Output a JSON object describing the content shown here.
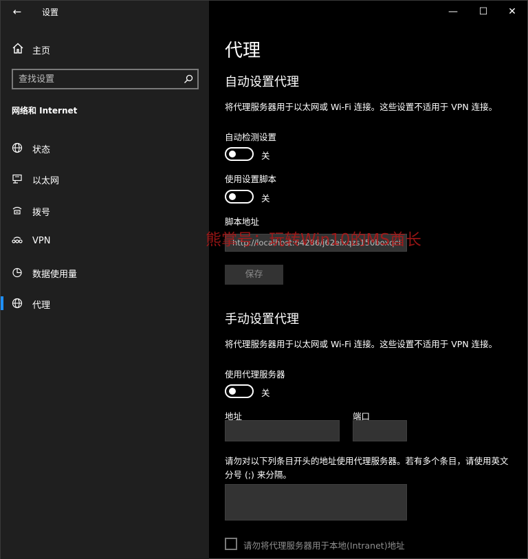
{
  "window": {
    "title": "设置",
    "controls": {
      "minimize": "—",
      "maximize": "☐",
      "close": "✕"
    }
  },
  "sidebar": {
    "home_label": "主页",
    "search_placeholder": "查找设置",
    "section_title": "网络和 Internet",
    "items": [
      {
        "label": "状态",
        "icon": "globe-status-icon"
      },
      {
        "label": "以太网",
        "icon": "ethernet-icon"
      },
      {
        "label": "拨号",
        "icon": "dialup-icon"
      },
      {
        "label": "VPN",
        "icon": "vpn-icon"
      },
      {
        "label": "数据使用量",
        "icon": "data-usage-icon"
      },
      {
        "label": "代理",
        "icon": "globe-icon",
        "selected": true
      }
    ]
  },
  "main": {
    "title": "代理",
    "auto": {
      "heading": "自动设置代理",
      "description": "将代理服务器用于以太网或 Wi-Fi 连接。这些设置不适用于 VPN 连接。",
      "detect_label": "自动检测设置",
      "detect_state": "关",
      "script_label": "使用设置脚本",
      "script_state": "关",
      "address_label": "脚本地址",
      "address_value": "http://localhost:64286/j62eixqzs150boxqcl",
      "save_label": "保存"
    },
    "manual": {
      "heading": "手动设置代理",
      "description": "将代理服务器用于以太网或 Wi-Fi 连接。这些设置不适用于 VPN 连接。",
      "use_proxy_label": "使用代理服务器",
      "use_proxy_state": "关",
      "address_label": "地址",
      "address_value": "",
      "port_label": "端口",
      "port_value": "",
      "exceptions_description": "请勿对以下列条目开头的地址使用代理服务器。若有多个条目，请使用英文分号 (;) 来分隔。",
      "exceptions_value": "",
      "local_bypass_label": "请勿将代理服务器用于本地(Intranet)地址"
    },
    "watermark": "熊掌号：玩转Win10的MS酋长"
  },
  "colors": {
    "accent": "#1e90ff",
    "sidebar_bg": "#1f1f1f",
    "main_bg": "#000000",
    "watermark": "#b01818"
  }
}
